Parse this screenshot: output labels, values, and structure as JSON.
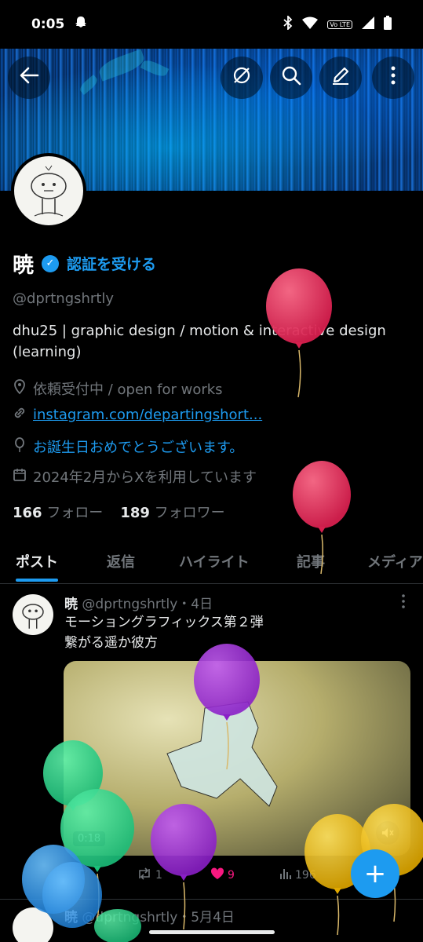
{
  "status_bar": {
    "time": "0:05",
    "network_badge": "Vo LTE"
  },
  "colors": {
    "accent": "#1d9bf0",
    "like": "#f91880",
    "muted_text": "#71767b",
    "background": "#000000"
  },
  "profile": {
    "name": "暁",
    "verify_cta": "認証を受ける",
    "handle": "@dprtngshrtly",
    "bio_line1": "dhu25 | graphic design / motion & interactive design",
    "bio_line2": "(learning)",
    "location": "依頼受付中 / open for works",
    "website": "instagram.com/departingshort...",
    "birthday": "お誕生日おめでとうございます。",
    "joined": "2024年2月からXを利用しています",
    "following_count": "166",
    "following_label": "フォロー",
    "followers_count": "189",
    "followers_label": "フォロワー"
  },
  "tabs": [
    {
      "label": "ポスト",
      "active": true
    },
    {
      "label": "返信",
      "active": false
    },
    {
      "label": "ハイライト",
      "active": false
    },
    {
      "label": "記事",
      "active": false
    },
    {
      "label": "メディア",
      "active": false
    }
  ],
  "post": {
    "author": "暁",
    "handle": "@dprtngshrtly",
    "time": "・4日",
    "line1": "モーショングラフィックス第２弾",
    "line2": "繋がる遥か彼方",
    "video_duration": "0:18",
    "retweets": "1",
    "likes": "9",
    "views": "196"
  },
  "next_post": {
    "author": "暁",
    "handle": "@dprtngshrtly",
    "time": "・5月4日"
  },
  "icons": {
    "back": "←",
    "hide": "⊘",
    "search": "⌕",
    "edit": "✎",
    "more": "⋮",
    "location": "◎",
    "link": "⊃",
    "balloon": "○",
    "calendar": "▦",
    "retweet": "⇄",
    "like": "♥",
    "views": "▮",
    "compose": "+",
    "mute": "🔇",
    "verified": "✓"
  }
}
